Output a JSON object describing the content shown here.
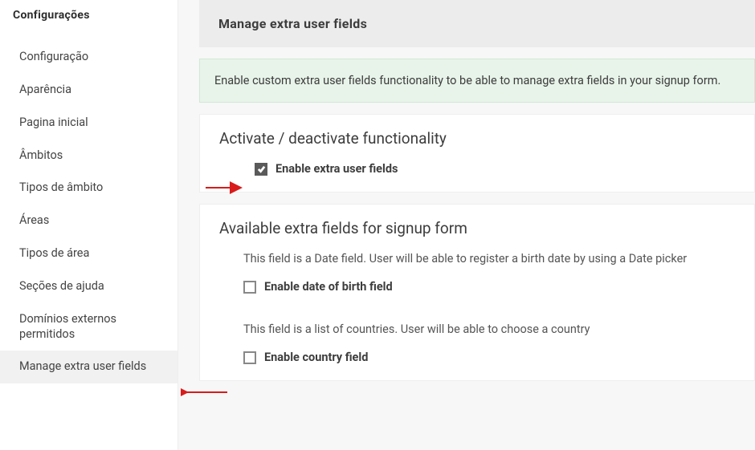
{
  "sidebar": {
    "title": "Configurações",
    "items": [
      {
        "label": "Configuração"
      },
      {
        "label": "Aparência"
      },
      {
        "label": "Pagina inicial"
      },
      {
        "label": "Âmbitos"
      },
      {
        "label": "Tipos de âmbito"
      },
      {
        "label": "Áreas"
      },
      {
        "label": "Tipos de área"
      },
      {
        "label": "Seções de ajuda"
      },
      {
        "label": "Domínios externos permitidos"
      },
      {
        "label": "Manage extra user fields"
      }
    ]
  },
  "page": {
    "title": "Manage extra user fields"
  },
  "info": {
    "text": "Enable custom extra user fields functionality to be able to manage extra fields in your signup form."
  },
  "activate": {
    "heading": "Activate / deactivate functionality",
    "checkbox_label": "Enable extra user fields"
  },
  "available": {
    "heading": "Available extra fields for signup form",
    "fields": [
      {
        "desc": "This field is a Date field. User will be able to register a birth date by using a Date picker",
        "label": "Enable date of birth field"
      },
      {
        "desc": "This field is a list of countries. User will be able to choose a country",
        "label": "Enable country field"
      }
    ]
  }
}
